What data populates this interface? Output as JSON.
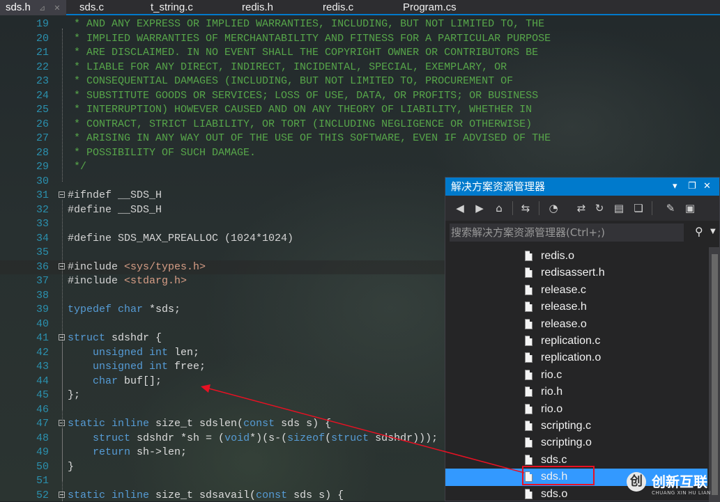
{
  "tabs": [
    {
      "label": "sds.h",
      "active": true
    },
    {
      "label": "sds.c",
      "active": false
    },
    {
      "label": "t_string.c",
      "active": false
    },
    {
      "label": "redis.h",
      "active": false
    },
    {
      "label": "redis.c",
      "active": false
    },
    {
      "label": "Program.cs",
      "active": false
    }
  ],
  "tab_controls": {
    "pin": "⊿",
    "close": "✕"
  },
  "editor": {
    "lines": [
      {
        "n": "19",
        "parts": [
          {
            "t": " * AND ANY EXPRESS OR IMPLIED WARRANTIES, INCLUDING, BUT NOT LIMITED TO, THE",
            "c": "com"
          }
        ]
      },
      {
        "n": "20",
        "parts": [
          {
            "t": " * IMPLIED WARRANTIES OF MERCHANTABILITY AND FITNESS FOR A PARTICULAR PURPOSE",
            "c": "com"
          }
        ]
      },
      {
        "n": "21",
        "parts": [
          {
            "t": " * ARE DISCLAIMED. IN NO EVENT SHALL THE COPYRIGHT OWNER OR CONTRIBUTORS BE",
            "c": "com"
          }
        ]
      },
      {
        "n": "22",
        "parts": [
          {
            "t": " * LIABLE FOR ANY DIRECT, INDIRECT, INCIDENTAL, SPECIAL, EXEMPLARY, OR",
            "c": "com"
          }
        ]
      },
      {
        "n": "23",
        "parts": [
          {
            "t": " * CONSEQUENTIAL DAMAGES (INCLUDING, BUT NOT LIMITED TO, PROCUREMENT OF",
            "c": "com"
          }
        ]
      },
      {
        "n": "24",
        "parts": [
          {
            "t": " * SUBSTITUTE GOODS OR SERVICES; LOSS OF USE, DATA, OR PROFITS; OR BUSINESS",
            "c": "com"
          }
        ]
      },
      {
        "n": "25",
        "parts": [
          {
            "t": " * INTERRUPTION) HOWEVER CAUSED AND ON ANY THEORY OF LIABILITY, WHETHER IN",
            "c": "com"
          }
        ]
      },
      {
        "n": "26",
        "parts": [
          {
            "t": " * CONTRACT, STRICT LIABILITY, OR TORT (INCLUDING NEGLIGENCE OR OTHERWISE)",
            "c": "com"
          }
        ]
      },
      {
        "n": "27",
        "parts": [
          {
            "t": " * ARISING IN ANY WAY OUT OF THE USE OF THIS SOFTWARE, EVEN IF ADVISED OF THE",
            "c": "com"
          }
        ]
      },
      {
        "n": "28",
        "parts": [
          {
            "t": " * POSSIBILITY OF SUCH DAMAGE.",
            "c": "com"
          }
        ]
      },
      {
        "n": "29",
        "parts": [
          {
            "t": " */",
            "c": "com"
          }
        ]
      },
      {
        "n": "30",
        "parts": []
      },
      {
        "n": "31",
        "fold": true,
        "parts": [
          {
            "t": "#ifndef __SDS_H",
            "c": "pp"
          }
        ]
      },
      {
        "n": "32",
        "parts": [
          {
            "t": "#define __SDS_H",
            "c": "pp"
          }
        ]
      },
      {
        "n": "33",
        "parts": []
      },
      {
        "n": "34",
        "parts": [
          {
            "t": "#define SDS_MAX_PREALLOC (1024*1024)",
            "c": "pp"
          }
        ]
      },
      {
        "n": "35",
        "parts": []
      },
      {
        "n": "36",
        "fold": true,
        "hl": true,
        "parts": [
          {
            "t": "#include ",
            "c": "pp"
          },
          {
            "t": "<sys/types.h>",
            "c": "inc"
          }
        ]
      },
      {
        "n": "37",
        "parts": [
          {
            "t": "#include ",
            "c": "pp"
          },
          {
            "t": "<stdarg.h>",
            "c": "inc"
          }
        ]
      },
      {
        "n": "38",
        "parts": []
      },
      {
        "n": "39",
        "parts": [
          {
            "t": "typedef char ",
            "c": "kw"
          },
          {
            "t": "*sds;",
            "c": "txt"
          }
        ]
      },
      {
        "n": "40",
        "parts": []
      },
      {
        "n": "41",
        "fold": true,
        "parts": [
          {
            "t": "struct ",
            "c": "kw"
          },
          {
            "t": "sdshdr {",
            "c": "txt"
          }
        ]
      },
      {
        "n": "42",
        "parts": [
          {
            "t": "    unsigned int ",
            "c": "kw"
          },
          {
            "t": "len;",
            "c": "txt"
          }
        ]
      },
      {
        "n": "43",
        "parts": [
          {
            "t": "    unsigned int ",
            "c": "kw"
          },
          {
            "t": "free;",
            "c": "txt"
          }
        ]
      },
      {
        "n": "44",
        "parts": [
          {
            "t": "    char ",
            "c": "kw"
          },
          {
            "t": "buf[];",
            "c": "txt"
          }
        ]
      },
      {
        "n": "45",
        "parts": [
          {
            "t": "};",
            "c": "txt"
          }
        ]
      },
      {
        "n": "46",
        "parts": []
      },
      {
        "n": "47",
        "fold": true,
        "parts": [
          {
            "t": "static inline ",
            "c": "kw"
          },
          {
            "t": "size_t sdslen(",
            "c": "txt"
          },
          {
            "t": "const ",
            "c": "kw"
          },
          {
            "t": "sds s) {",
            "c": "txt"
          }
        ]
      },
      {
        "n": "48",
        "parts": [
          {
            "t": "    struct ",
            "c": "kw"
          },
          {
            "t": "sdshdr *sh = (",
            "c": "txt"
          },
          {
            "t": "void",
            "c": "kw"
          },
          {
            "t": "*)(s-(",
            "c": "txt"
          },
          {
            "t": "sizeof",
            "c": "kw"
          },
          {
            "t": "(",
            "c": "txt"
          },
          {
            "t": "struct ",
            "c": "kw"
          },
          {
            "t": "sdshdr)));",
            "c": "txt"
          }
        ]
      },
      {
        "n": "49",
        "parts": [
          {
            "t": "    return ",
            "c": "kw"
          },
          {
            "t": "sh->len;",
            "c": "txt"
          }
        ]
      },
      {
        "n": "50",
        "parts": [
          {
            "t": "}",
            "c": "txt"
          }
        ]
      },
      {
        "n": "51",
        "parts": []
      },
      {
        "n": "52",
        "fold": true,
        "parts": [
          {
            "t": "static inline ",
            "c": "kw"
          },
          {
            "t": "size_t sdsavail(",
            "c": "txt"
          },
          {
            "t": "const ",
            "c": "kw"
          },
          {
            "t": "sds s) {",
            "c": "txt"
          }
        ]
      }
    ]
  },
  "solution_explorer": {
    "title": "解决方案资源管理器",
    "title_controls": {
      "dropdown": "▾",
      "maximize": "❐",
      "close": "✕"
    },
    "toolbar_icons": [
      "back-icon",
      "forward-icon",
      "home-icon",
      "sync-icon",
      "history-icon",
      "refresh-icon",
      "collapse-icon",
      "show-all-icon",
      "properties-icon",
      "preview-icon"
    ],
    "search_placeholder": "搜索解决方案资源管理器(Ctrl+;)",
    "files": [
      {
        "name": "redis.o",
        "selected": false
      },
      {
        "name": "redisassert.h",
        "selected": false
      },
      {
        "name": "release.c",
        "selected": false
      },
      {
        "name": "release.h",
        "selected": false
      },
      {
        "name": "release.o",
        "selected": false
      },
      {
        "name": "replication.c",
        "selected": false
      },
      {
        "name": "replication.o",
        "selected": false
      },
      {
        "name": "rio.c",
        "selected": false
      },
      {
        "name": "rio.h",
        "selected": false
      },
      {
        "name": "rio.o",
        "selected": false
      },
      {
        "name": "scripting.c",
        "selected": false
      },
      {
        "name": "scripting.o",
        "selected": false
      },
      {
        "name": "sds.c",
        "selected": false
      },
      {
        "name": "sds.h",
        "selected": true
      },
      {
        "name": "sds.o",
        "selected": false
      }
    ]
  },
  "watermark": {
    "logo_letter": "创",
    "text": "创新互联",
    "subtext": "CHUANG XIN HU LIAN"
  },
  "colors": {
    "accent": "#007acc",
    "selection": "#3399ff",
    "annotation": "#e81123",
    "comment": "#57a64a",
    "keyword": "#569cd6"
  }
}
